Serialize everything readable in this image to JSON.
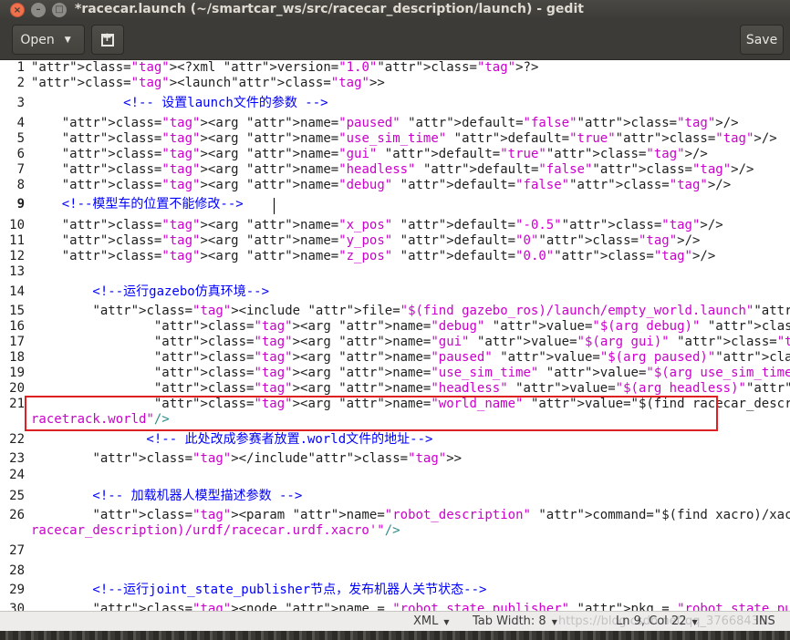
{
  "window": {
    "title": "*racecar.launch (~/smartcar_ws/src/racecar_description/launch) - gedit",
    "close_glyph": "×",
    "min_glyph": "–",
    "max_glyph": "□"
  },
  "toolbar": {
    "open_label": "Open",
    "open_arrow": "▼",
    "new_tab_icon": "new-tab-icon",
    "save_label": "Save"
  },
  "editor": {
    "line_numbers": [
      "1",
      "2",
      "3",
      "4",
      "5",
      "6",
      "7",
      "8",
      "9",
      "10",
      "11",
      "12",
      "13",
      "14",
      "15",
      "16",
      "17",
      "18",
      "19",
      "20",
      "21",
      "22",
      "23",
      "24",
      "25",
      "26",
      "27",
      "28",
      "29",
      "30"
    ],
    "current_line": "9",
    "lines": [
      "<?xml version=\"1.0\"?>",
      "<launch>",
      "            <!-- 设置launch文件的参数 -->",
      "    <arg name=\"paused\" default=\"false\"/>",
      "    <arg name=\"use_sim_time\" default=\"true\"/>",
      "    <arg name=\"gui\" default=\"true\"/>",
      "    <arg name=\"headless\" default=\"false\"/>",
      "    <arg name=\"debug\" default=\"false\"/>",
      "    <!--模型车的位置不能修改-->",
      "    <arg name=\"x_pos\" default=\"-0.5\"/>",
      "    <arg name=\"y_pos\" default=\"0\"/>",
      "    <arg name=\"z_pos\" default=\"0.0\"/>",
      "",
      "        <!--运行gazebo仿真环境-->",
      "        <include file=\"$(find gazebo_ros)/launch/empty_world.launch\">",
      "                <arg name=\"debug\" value=\"$(arg debug)\" />",
      "                <arg name=\"gui\" value=\"$(arg gui)\" />",
      "                <arg name=\"paused\" value=\"$(arg paused)\"/>",
      "                <arg name=\"use_sim_time\" value=\"$(arg use_sim_time)\"/>",
      "                <arg name=\"headless\" value=\"$(arg headless)\"/>",
      "                <arg name=\"world_name\" value=\"$(find racecar_description)/worlds/",
      "racetrack.world\"/>",
      "               <!-- 此处改成参赛者放置.world文件的地址-->",
      "        </include>",
      "",
      "        <!-- 加载机器人模型描述参数 -->",
      "        <param name=\"robot_description\" command=\"$(find xacro)/xacro --inorder '$(find",
      "racecar_description)/urdf/racecar.urdf.xacro'\"/>",
      "",
      "",
      "        <!--运行joint_state_publisher节点，发布机器人关节状态-->",
      "        <node name = \"robot_state_publisher\" pkg = \"robot_state_publisher\" type ="
    ]
  },
  "statusbar": {
    "language": "XML",
    "tab_width": "Tab Width: 8",
    "position": "Ln 9, Col 22",
    "mode": "INS",
    "arrow": "▼",
    "watermark": "https://blog.csdn.net/qq_37668436"
  }
}
